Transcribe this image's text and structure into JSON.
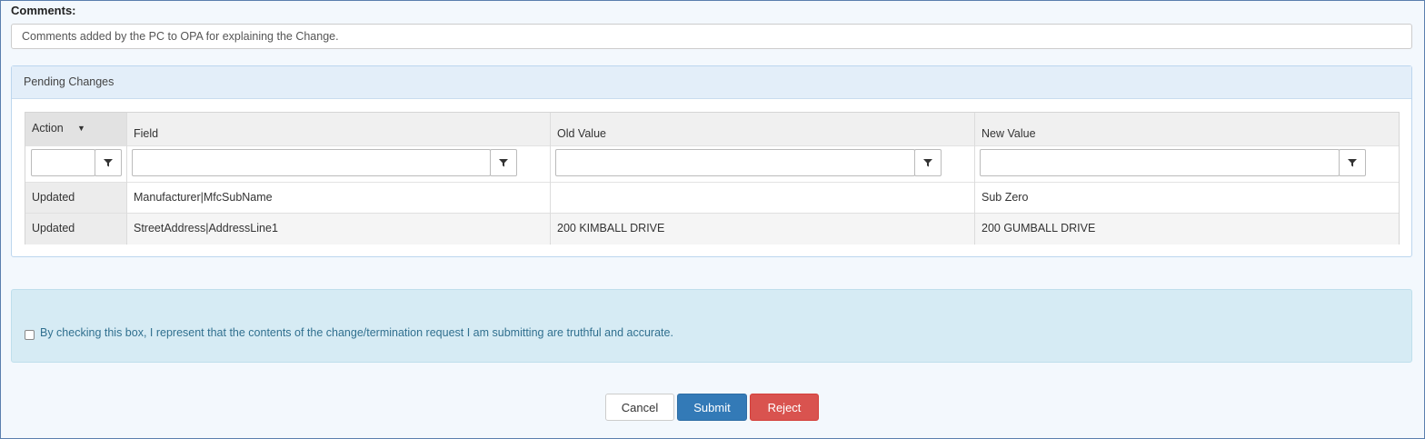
{
  "comments": {
    "label": "Comments:",
    "text": "Comments added by the PC to OPA for explaining the Change."
  },
  "panel": {
    "title": "Pending Changes",
    "columns": [
      {
        "label": "Action",
        "sort_indicator": "▼"
      },
      {
        "label": "Field"
      },
      {
        "label": "Old Value"
      },
      {
        "label": "New Value"
      }
    ],
    "rows": [
      {
        "action": "Updated",
        "field": "Manufacturer|MfcSubName",
        "old_value": "",
        "new_value": "Sub Zero"
      },
      {
        "action": "Updated",
        "field": "StreetAddress|AddressLine1",
        "old_value": "200 KIMBALL DRIVE",
        "new_value": "200 GUMBALL DRIVE"
      }
    ],
    "filter_icon": "filter-funnel-icon"
  },
  "attestation": {
    "checked": false,
    "text": "By checking this box, I represent that the contents of the change/termination request I am submitting are truthful and accurate."
  },
  "buttons": {
    "cancel": "Cancel",
    "submit": "Submit",
    "reject": "Reject"
  },
  "colors": {
    "submit": "#337ab7",
    "reject": "#d9534f",
    "notice_bg": "#d6ebf4",
    "notice_text": "#31708f",
    "panel_heading_bg": "#e3eef9"
  }
}
